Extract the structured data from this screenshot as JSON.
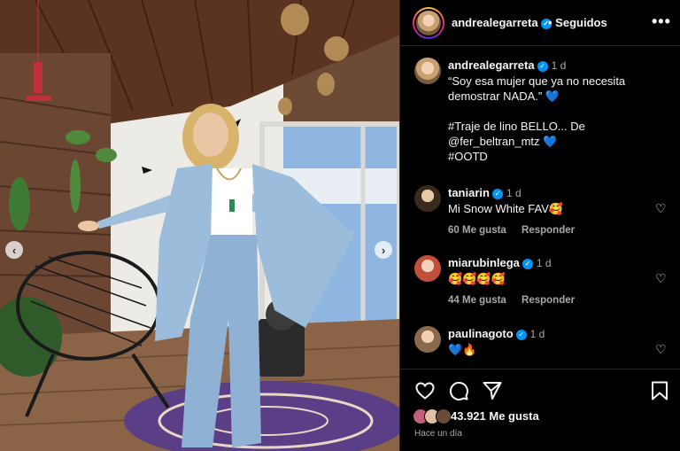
{
  "post": {
    "username": "andrealegarreta",
    "follow_label": "Seguidos",
    "more_label": "•••"
  },
  "caption": {
    "username": "andrealegarreta",
    "time": "1 d",
    "text": "“Soy esa mujer que ya no necesita demostrar NADA.” 💙\n\n#Traje de lino BELLO... De @fer_beltran_mtz 💙\n#OOTD"
  },
  "comments": [
    {
      "username": "taniarin",
      "time": "1 d",
      "text": "Mi Snow White FAV🥰",
      "likes": "60 Me gusta",
      "reply": "Responder"
    },
    {
      "username": "miarubinlega",
      "time": "1 d",
      "text": "🥰🥰🥰🥰",
      "likes": "44 Me gusta",
      "reply": "Responder"
    },
    {
      "username": "paulinagoto",
      "time": "1 d",
      "text": "💙🔥",
      "likes": "",
      "reply": ""
    }
  ],
  "footer": {
    "likes": "43.921 Me gusta",
    "ago": "Hace un día"
  },
  "icons": {
    "heart": "heart-icon",
    "comment": "comment-icon",
    "share": "share-icon",
    "save": "bookmark-icon",
    "verified": "verified-badge-icon",
    "carousel_prev": "chevron-left-icon",
    "carousel_next": "chevron-right-icon"
  },
  "colors": {
    "background": "#000000",
    "text": "#f5f5f5",
    "muted": "#a8a8a8",
    "verified": "#0095f6"
  }
}
